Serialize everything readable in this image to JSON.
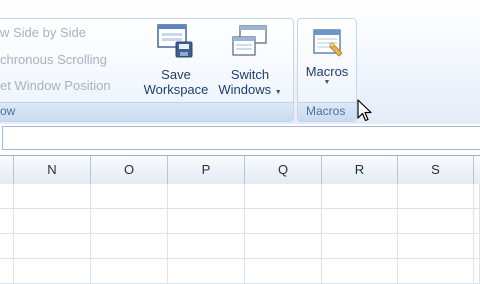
{
  "ribbon": {
    "window_group": {
      "items": [
        "w Side by Side",
        "chronous Scrolling",
        "et Window Position"
      ],
      "label": "ow",
      "save_workspace": [
        "Save",
        "Workspace"
      ],
      "switch_windows": [
        "Switch",
        "Windows"
      ]
    },
    "macros_group": {
      "button_label": "Macros",
      "label": "Macros"
    }
  },
  "sheet": {
    "columns": [
      "N",
      "O",
      "P",
      "Q",
      "R",
      "S"
    ]
  }
}
